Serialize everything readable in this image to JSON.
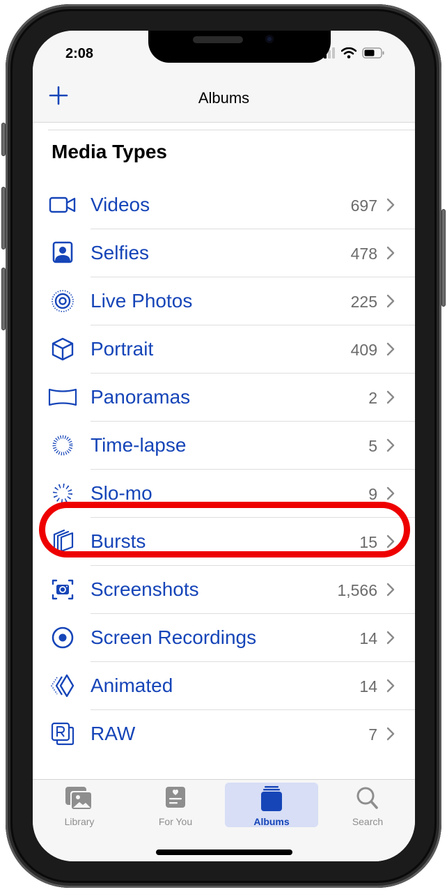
{
  "status_bar": {
    "time": "2:08",
    "icons": [
      "cellular-signal-icon",
      "wifi-icon",
      "battery-icon"
    ]
  },
  "nav": {
    "title": "Albums",
    "add_icon": "plus-icon"
  },
  "section": {
    "title": "Media Types"
  },
  "colors": {
    "accent": "#1645b8",
    "count_text": "#6b6b6b",
    "highlight": "#ee0000",
    "tab_inactive": "#8e8e8e",
    "tab_active_bg": "#d7def5"
  },
  "media_types": [
    {
      "icon": "video-camera-icon",
      "label": "Videos",
      "count": "697"
    },
    {
      "icon": "selfie-portrait-icon",
      "label": "Selfies",
      "count": "478"
    },
    {
      "icon": "live-photo-icon",
      "label": "Live Photos",
      "count": "225"
    },
    {
      "icon": "portrait-cube-icon",
      "label": "Portrait",
      "count": "409"
    },
    {
      "icon": "panorama-icon",
      "label": "Panoramas",
      "count": "2"
    },
    {
      "icon": "time-lapse-icon",
      "label": "Time-lapse",
      "count": "5"
    },
    {
      "icon": "slo-mo-icon",
      "label": "Slo-mo",
      "count": "9"
    },
    {
      "icon": "bursts-icon",
      "label": "Bursts",
      "count": "15",
      "highlighted": true
    },
    {
      "icon": "screenshot-icon",
      "label": "Screenshots",
      "count": "1,566"
    },
    {
      "icon": "screen-recording-icon",
      "label": "Screen Recordings",
      "count": "14"
    },
    {
      "icon": "animated-icon",
      "label": "Animated",
      "count": "14"
    },
    {
      "icon": "raw-icon",
      "label": "RAW",
      "count": "7"
    }
  ],
  "tab_bar": {
    "tabs": [
      {
        "icon": "library-photos-icon",
        "label": "Library",
        "active": false
      },
      {
        "icon": "for-you-icon",
        "label": "For You",
        "active": false
      },
      {
        "icon": "albums-stack-icon",
        "label": "Albums",
        "active": true
      },
      {
        "icon": "search-icon",
        "label": "Search",
        "active": false
      }
    ]
  }
}
